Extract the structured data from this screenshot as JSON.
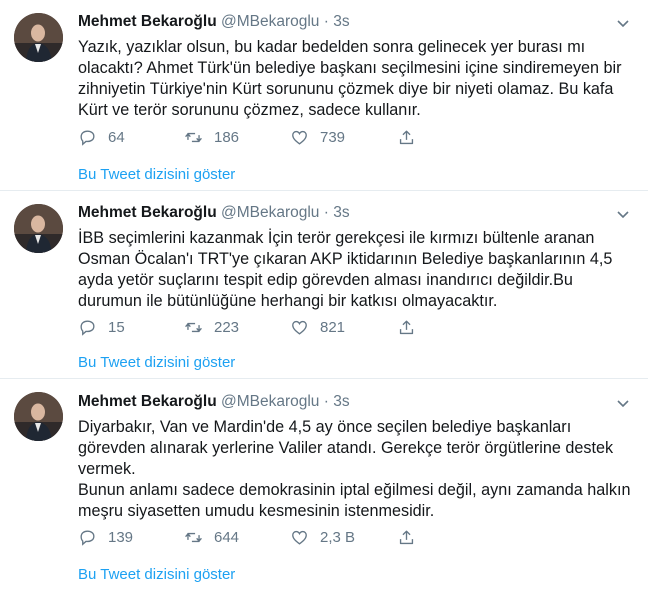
{
  "tweets": [
    {
      "name": "Mehmet Bekaroğlu",
      "handle": "@MBekaroglu",
      "dot": "·",
      "time": "3s",
      "lines": [
        "Yazık, yazıklar olsun, bu kadar bedelden sonra gelinecek yer burası mı",
        "olacaktı? Ahmet Türk'ün belediye başkanı seçilmesini içine sindiremeyen bir",
        "zihniyetin Türkiye'nin Kürt sorununu çözmek diye bir niyeti olamaz. Bu kafa",
        "Kürt ve terör sorununu çözmez, sadece kullanır."
      ],
      "replies": "64",
      "retweets": "186",
      "likes": "739",
      "show_thread": "Bu Tweet dizisini göster"
    },
    {
      "name": "Mehmet Bekaroğlu",
      "handle": "@MBekaroglu",
      "dot": "·",
      "time": "3s",
      "lines": [
        "İBB seçimlerini kazanmak İçin terör gerekçesi ile kırmızı bültenle aranan",
        "Osman Öcalan'ı TRT'ye çıkaran AKP iktidarının Belediye başkanlarının 4,5",
        "ayda yetör suçlarını tespit edip görevden alması inandırıcı değildir.Bu",
        "durumun ile bütünlüğüne herhangi bir katkısı olmayacaktır."
      ],
      "replies": "15",
      "retweets": "223",
      "likes": "821",
      "show_thread": "Bu Tweet dizisini göster"
    },
    {
      "name": "Mehmet Bekaroğlu",
      "handle": "@MBekaroglu",
      "dot": "·",
      "time": "3s",
      "lines": [
        "Diyarbakır, Van ve Mardin'de 4,5 ay önce seçilen belediye başkanları",
        "görevden alınarak yerlerine Valiler atandı. Gerekçe terör örgütlerine destek",
        "vermek.",
        "Bunun anlamı sadece demokrasinin iptal eğilmesi değil, aynı zamanda halkın",
        "meşru siyasetten umudu kesmesinin istenmesidir."
      ],
      "replies": "139",
      "retweets": "644",
      "likes": "2,3 B",
      "show_thread": "Bu Tweet dizisini göster"
    }
  ],
  "colors": {
    "link": "#1da1f2",
    "secondary_text": "#657786",
    "separator": "#e6ecf0"
  },
  "icons": {
    "reply": "reply-icon",
    "retweet": "retweet-icon",
    "like": "like-icon",
    "share": "share-icon",
    "caret": "chevron-down-icon"
  }
}
